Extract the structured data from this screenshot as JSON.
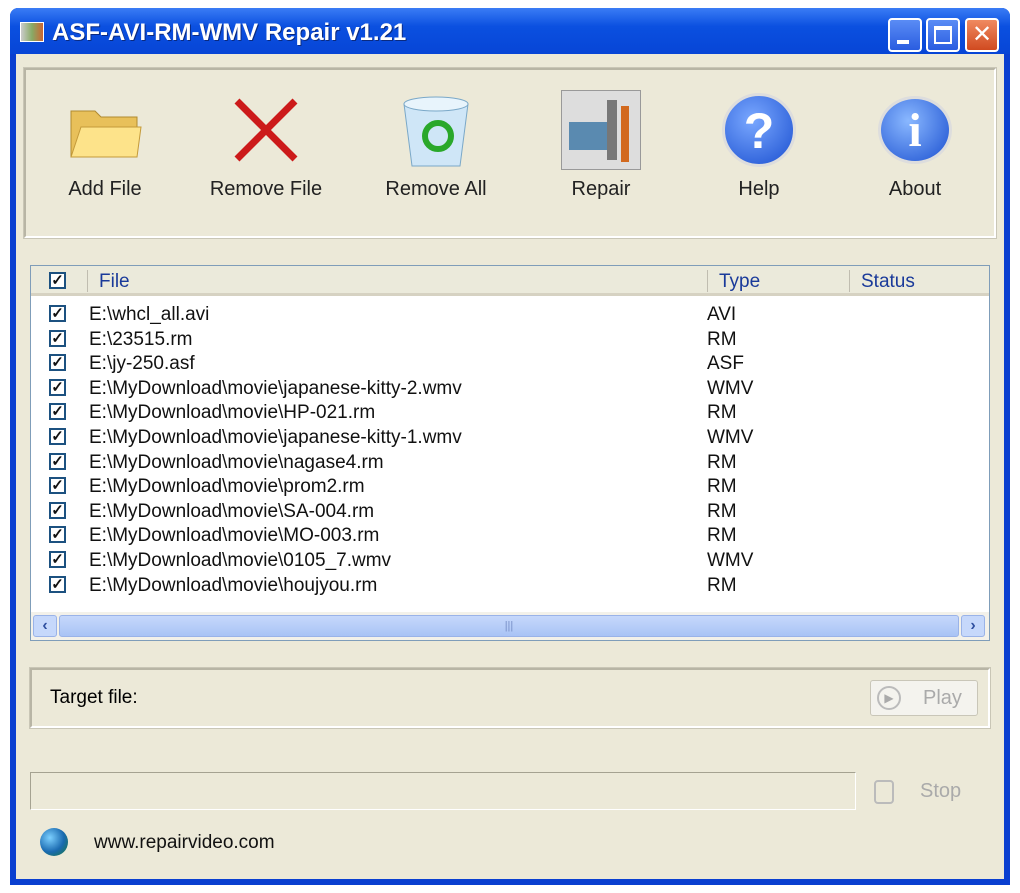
{
  "window": {
    "title": "ASF-AVI-RM-WMV Repair v1.21"
  },
  "toolbar": [
    {
      "label": "Add File",
      "icon": "folder-icon"
    },
    {
      "label": "Remove File",
      "icon": "x-icon"
    },
    {
      "label": "Remove All",
      "icon": "recycle-bin-icon"
    },
    {
      "label": "Repair",
      "icon": "repair-tools-icon"
    },
    {
      "label": "Help",
      "icon": "help-icon"
    },
    {
      "label": "About",
      "icon": "info-icon"
    }
  ],
  "list": {
    "columns": {
      "file": "File",
      "type": "Type",
      "status": "Status"
    },
    "rows": [
      {
        "file": "E:\\whcl_all.avi",
        "type": "AVI",
        "checked": true
      },
      {
        "file": "E:\\23515.rm",
        "type": "RM",
        "checked": true
      },
      {
        "file": "E:\\jy-250.asf",
        "type": "ASF",
        "checked": true
      },
      {
        "file": "E:\\MyDownload\\movie\\japanese-kitty-2.wmv",
        "type": "WMV",
        "checked": true
      },
      {
        "file": "E:\\MyDownload\\movie\\HP-021.rm",
        "type": "RM",
        "checked": true
      },
      {
        "file": "E:\\MyDownload\\movie\\japanese-kitty-1.wmv",
        "type": "WMV",
        "checked": true
      },
      {
        "file": "E:\\MyDownload\\movie\\nagase4.rm",
        "type": "RM",
        "checked": true
      },
      {
        "file": "E:\\MyDownload\\movie\\prom2.rm",
        "type": "RM",
        "checked": true
      },
      {
        "file": "E:\\MyDownload\\movie\\SA-004.rm",
        "type": "RM",
        "checked": true
      },
      {
        "file": "E:\\MyDownload\\movie\\MO-003.rm",
        "type": "RM",
        "checked": true
      },
      {
        "file": "E:\\MyDownload\\movie\\0105_7.wmv",
        "type": "WMV",
        "checked": true
      },
      {
        "file": "E:\\MyDownload\\movie\\houjyou.rm",
        "type": "RM",
        "checked": true
      }
    ]
  },
  "target": {
    "label": "Target file:",
    "play": "Play"
  },
  "progress": {
    "value": 0,
    "stop": "Stop"
  },
  "footer": {
    "link": "www.repairvideo.com"
  }
}
